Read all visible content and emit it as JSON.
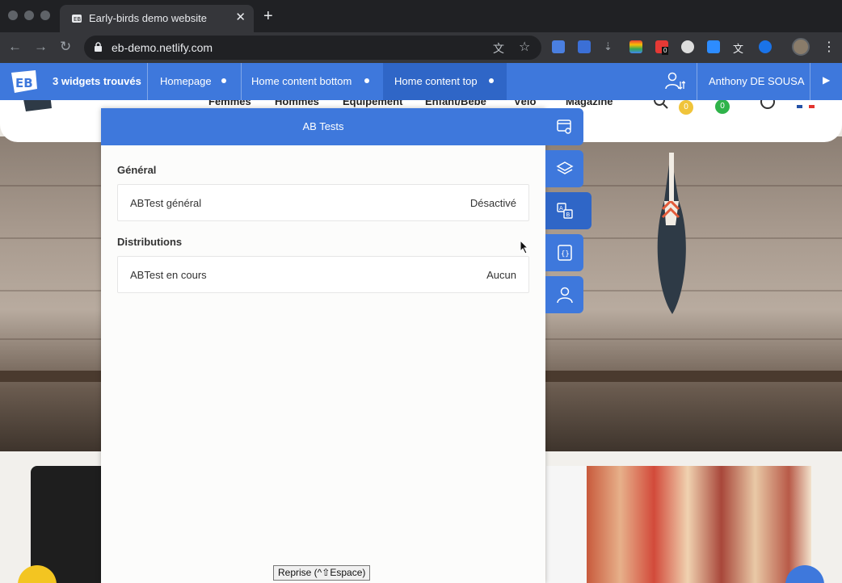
{
  "browser": {
    "tab_title": "Early-birds demo website",
    "tab_close": "✕",
    "new_tab": "+",
    "url": "eb-demo.netlify.com",
    "back": "←",
    "forward": "→",
    "reload": "↻",
    "star": "☆",
    "translate": "文",
    "ext_badge": "0",
    "menu": "⋮"
  },
  "widget_bar": {
    "count_label": "3 widgets trouvés",
    "items": [
      {
        "label": "Homepage"
      },
      {
        "label": "Home content bottom"
      },
      {
        "label": "Home content top"
      }
    ],
    "active_index": 2,
    "user_name": "Anthony DE SOUSA",
    "arrow": "▶"
  },
  "site": {
    "menu": [
      "Femmes",
      "Hommes",
      "Equipement",
      "Enfant/Bébé",
      "Vélo",
      "Magazine"
    ],
    "badge_cart": "0",
    "badge_wish": "0"
  },
  "panel": {
    "title": "AB Tests",
    "sections": [
      {
        "title": "Général",
        "rows": [
          {
            "label": "ABTest général",
            "value": "Désactivé"
          }
        ]
      },
      {
        "title": "Distributions",
        "rows": [
          {
            "label": "ABTest en cours",
            "value": "Aucun"
          }
        ]
      }
    ]
  },
  "side_tools": [
    "preview-link-icon",
    "layers-icon",
    "ab-test-icon",
    "code-icon",
    "user-icon"
  ],
  "tooltip": "Reprise (^⇧Espace)",
  "colors": {
    "accent": "#3e78dc",
    "accent_dark": "#2f66c7",
    "chrome_dark": "#202124",
    "chrome_toolbar": "#35363a"
  }
}
